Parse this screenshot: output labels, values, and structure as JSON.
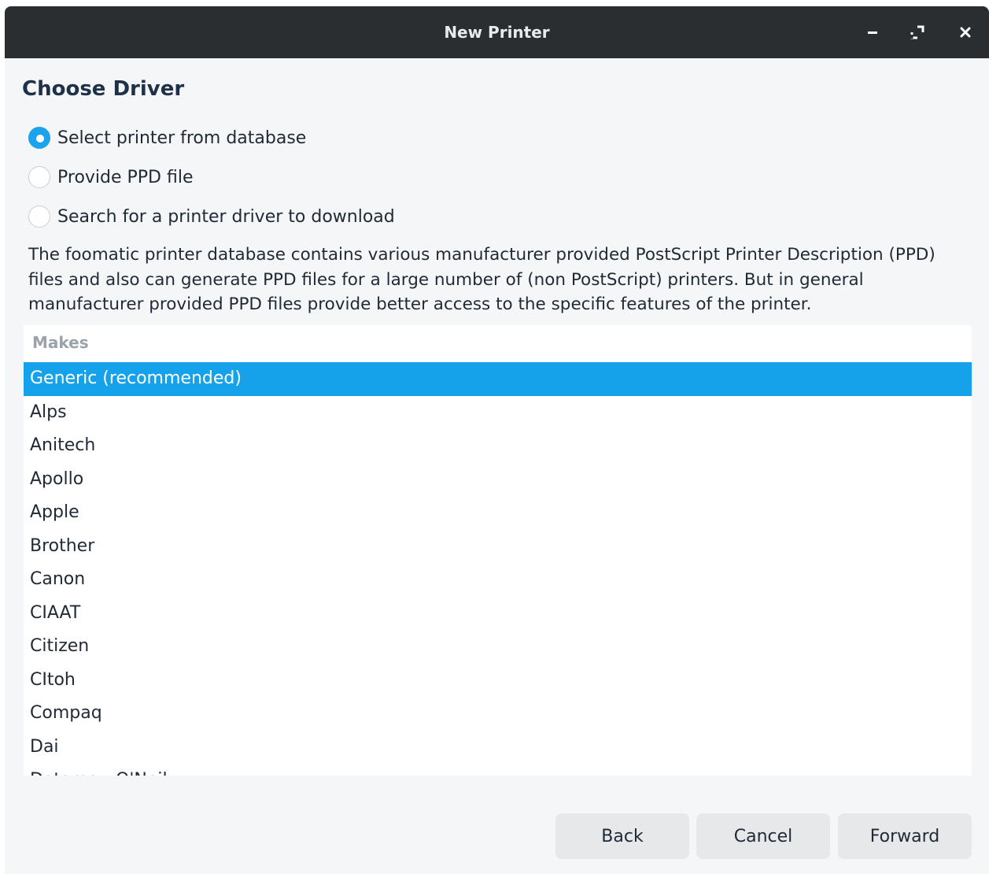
{
  "window": {
    "title": "New Printer",
    "controls": [
      "minimize-icon",
      "maximize-icon",
      "close-icon"
    ]
  },
  "heading": "Choose Driver",
  "options": [
    {
      "label": "Select printer from database",
      "checked": true
    },
    {
      "label": "Provide PPD file",
      "checked": false
    },
    {
      "label": "Search for a printer driver to download",
      "checked": false
    }
  ],
  "description": "The foomatic printer database contains various manufacturer provided PostScript Printer Description (PPD) files and also can generate PPD files for a large number of (non PostScript) printers. But in general manufacturer provided PPD files provide better access to the specific features of the printer.",
  "makes": {
    "header": "Makes",
    "selected": "Generic (recommended)",
    "items": [
      "Generic (recommended)",
      "Alps",
      "Anitech",
      "Apollo",
      "Apple",
      "Brother",
      "Canon",
      "CIAAT",
      "Citizen",
      "CItoh",
      "Compaq",
      "Dai",
      "Datamax-O'Neil"
    ]
  },
  "buttons": {
    "back": "Back",
    "cancel": "Cancel",
    "forward": "Forward"
  },
  "colors": {
    "accent": "#16a2ea",
    "titlebar": "#2b2e31",
    "background": "#f5f6f7"
  }
}
